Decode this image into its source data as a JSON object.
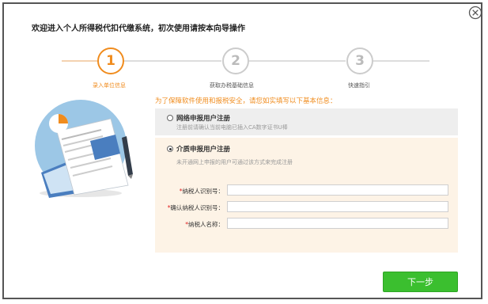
{
  "dialog": {
    "title": "欢迎进入个人所得税代扣代缴系统，初次使用请按本向导操作"
  },
  "steps": [
    {
      "number": "1",
      "label": "录入单位信息",
      "state": "active"
    },
    {
      "number": "2",
      "label": "获取办税基础信息",
      "state": "pending"
    },
    {
      "number": "3",
      "label": "快速指引",
      "state": "pending"
    }
  ],
  "form": {
    "hint": "为了保障软件使用和报税安全，请您如实填写以下基本信息：",
    "options": [
      {
        "title": "网络申报用户注册",
        "desc": "注册前请确认当前电脑已插入CA数字证书U棒",
        "selected": false
      },
      {
        "title": "介质申报用户注册",
        "desc": "未开通网上申报的用户可通过该方式来完成注册",
        "selected": true
      }
    ],
    "fields": [
      {
        "required": "*",
        "label": "纳税人识别号：",
        "value": ""
      },
      {
        "required": "*",
        "label": "确认纳税人识别号：",
        "value": ""
      },
      {
        "required": "*",
        "label": "纳税人名称：",
        "value": ""
      }
    ]
  },
  "buttons": {
    "next": "下一步"
  },
  "icons": {
    "close": "close-circle-icon"
  },
  "colors": {
    "accent": "#f08c1e",
    "primary_button": "#3bbf2f",
    "required": "#e02020"
  }
}
